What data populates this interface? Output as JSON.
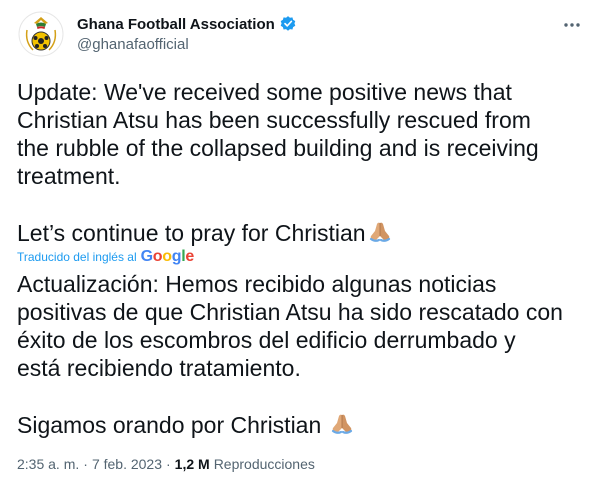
{
  "author": {
    "name": "Ghana Football Association",
    "handle": "@ghanafaofficial",
    "avatar_icon": "ghana-fa-crest-icon",
    "verified_icon": "verified-badge-icon"
  },
  "menu_icon": "more-options-icon",
  "tweet": {
    "original_lines": [
      "Update: We've received some positive news that",
      "Christian Atsu has been successfully rescued from",
      "the rubble of the collapsed building and is receiving",
      "treatment."
    ],
    "original_pray_line": "Let’s continue to pray for Christian",
    "translated_label": "Traducido del inglés al",
    "translator_logo": "Google",
    "translation_lines": [
      "Actualización: Hemos recibido algunas noticias",
      "positivas de que Christian Atsu ha sido rescatado con",
      "éxito de los escombros del edificio derrumbado y",
      "está recibiendo tratamiento."
    ],
    "translation_pray_line": "Sigamos orando por Christian"
  },
  "emoji_icon": "folded-hands-icon",
  "footer": {
    "time": "2:35 a. m.",
    "date": "7 feb. 2023",
    "separator": "·",
    "views_count": "1,2 M",
    "views_label": "Reproducciones"
  },
  "colors": {
    "text": "#0f1419",
    "secondary": "#536471",
    "accent": "#1d9bf0"
  }
}
